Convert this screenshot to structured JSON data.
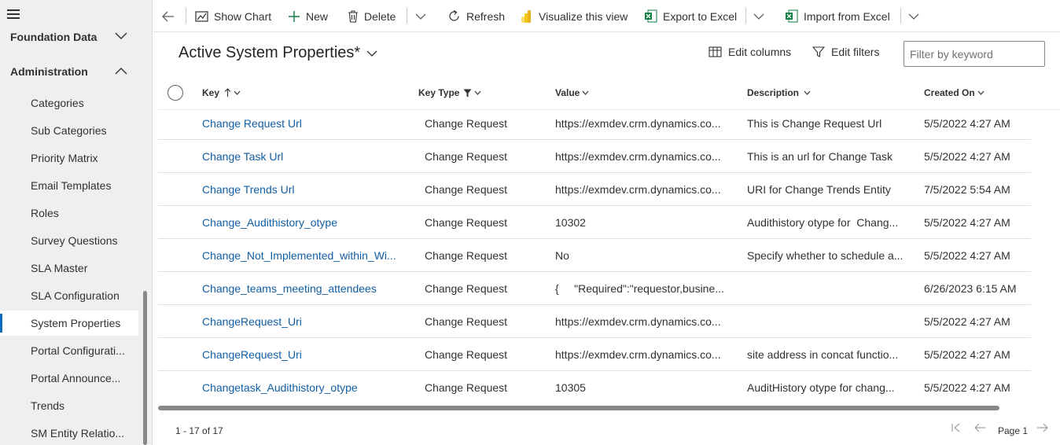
{
  "sidebar": {
    "groups": [
      {
        "label": "Foundation Data"
      },
      {
        "label": "Administration"
      }
    ],
    "items": [
      {
        "label": "Categories"
      },
      {
        "label": "Sub Categories"
      },
      {
        "label": "Priority Matrix"
      },
      {
        "label": "Email Templates"
      },
      {
        "label": "Roles"
      },
      {
        "label": "Survey Questions"
      },
      {
        "label": "SLA Master"
      },
      {
        "label": "SLA Configuration"
      },
      {
        "label": "System Properties"
      },
      {
        "label": "Portal Configurati..."
      },
      {
        "label": "Portal Announce..."
      },
      {
        "label": "Trends"
      },
      {
        "label": "SM Entity Relatio..."
      }
    ],
    "selected_item": "System Properties"
  },
  "commandbar": {
    "show_chart": "Show Chart",
    "new": "New",
    "delete": "Delete",
    "refresh": "Refresh",
    "visualize": "Visualize this view",
    "export_excel": "Export to Excel",
    "import_excel": "Import from Excel"
  },
  "view": {
    "title": "Active System Properties*",
    "edit_columns": "Edit columns",
    "edit_filters": "Edit filters",
    "search_placeholder": "Filter by keyword"
  },
  "grid": {
    "columns": {
      "key": "Key",
      "key_type": "Key Type",
      "value": "Value",
      "description": "Description",
      "created_on": "Created On"
    },
    "rows": [
      {
        "key": "Change Request Url",
        "key_type": "Change Request",
        "value": "https://exmdev.crm.dynamics.co...",
        "description": "This is Change Request Url",
        "created_on": "5/5/2022 4:27 AM"
      },
      {
        "key": "Change Task Url",
        "key_type": "Change Request",
        "value": "https://exmdev.crm.dynamics.co...",
        "description": "This is an url for Change Task",
        "created_on": "5/5/2022 4:27 AM"
      },
      {
        "key": "Change Trends Url",
        "key_type": "Change Request",
        "value": "https://exmdev.crm.dynamics.co...",
        "description": "URI for Change Trends Entity",
        "created_on": "7/5/2022 5:54 AM"
      },
      {
        "key": "Change_Audithistory_otype",
        "key_type": "Change Request",
        "value": "10302",
        "description": "Audithistory otype for  Chang...",
        "created_on": "5/5/2022 4:27 AM"
      },
      {
        "key": "Change_Not_Implemented_within_Wi...",
        "key_type": "Change Request",
        "value": "No",
        "description": "Specify whether to schedule a...",
        "created_on": "5/5/2022 4:27 AM"
      },
      {
        "key": "Change_teams_meeting_attendees",
        "key_type": "Change Request",
        "value": "{     \"Required\":\"requestor,busine...",
        "description": "",
        "created_on": "6/26/2023 6:15 AM"
      },
      {
        "key": "ChangeRequest_Uri",
        "key_type": "Change Request",
        "value": "https://exmdev.crm.dynamics.co...",
        "description": "",
        "created_on": "5/5/2022 4:27 AM"
      },
      {
        "key": "ChangeRequest_Uri",
        "key_type": "Change Request",
        "value": "https://exmdev.crm.dynamics.co...",
        "description": "site address in concat functio...",
        "created_on": "5/5/2022 4:27 AM"
      },
      {
        "key": "Changetask_Audithistory_otype",
        "key_type": "Change Request",
        "value": "10305",
        "description": "AuditHistory otype for chang...",
        "created_on": "5/5/2022 4:27 AM"
      }
    ]
  },
  "footer": {
    "record_count": "1 - 17 of 17",
    "page_label": "Page 1"
  },
  "colors": {
    "accent": "#0f6cbd",
    "link": "#115ea3",
    "excel_green": "#107c41"
  }
}
